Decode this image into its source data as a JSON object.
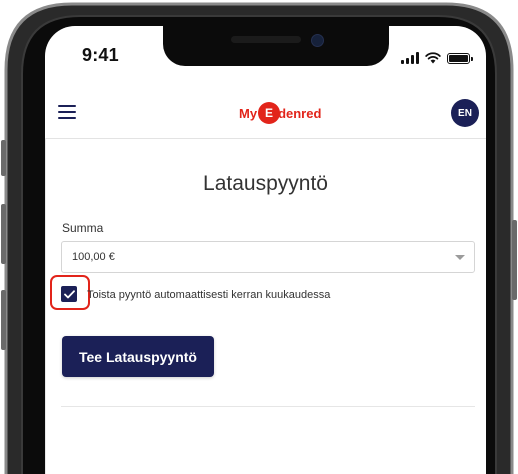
{
  "status_bar": {
    "time": "9:41"
  },
  "header": {
    "menu_icon": "hamburger-menu-icon",
    "logo_text_prefix": "My",
    "logo_circle": "E",
    "logo_text_suffix": "denred",
    "language": "EN"
  },
  "page": {
    "title": "Latauspyyntö"
  },
  "form": {
    "amount_label": "Summa",
    "amount_value": "100,00 €",
    "recurring_checked": true,
    "recurring_label": "Toista pyyntö automaattisesti kerran kuukaudessa",
    "submit_label": "Tee Latauspyyntö"
  },
  "colors": {
    "primary": "#1b2057",
    "brand_red": "#e2241a",
    "highlight": "#e2241a"
  }
}
